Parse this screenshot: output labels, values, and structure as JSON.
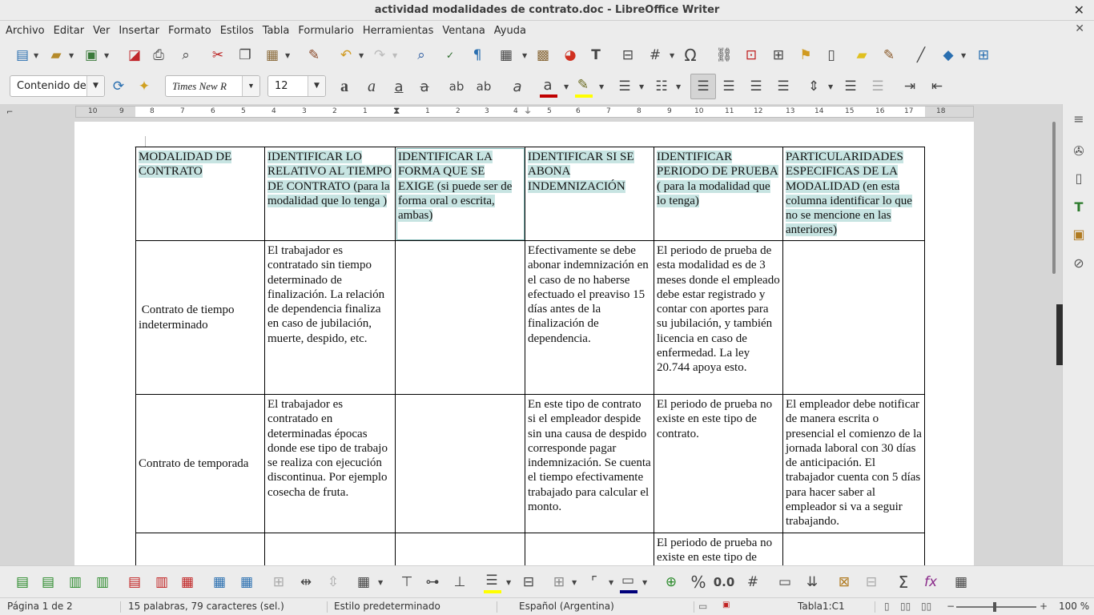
{
  "window": {
    "title": "actividad modalidades de contrato.doc - LibreOffice Writer",
    "close": "✕"
  },
  "menu": [
    "Archivo",
    "Editar",
    "Ver",
    "Insertar",
    "Formato",
    "Estilos",
    "Tabla",
    "Formulario",
    "Herramientas",
    "Ventana",
    "Ayuda"
  ],
  "format_bar": {
    "paragraph_style": "Contenido de",
    "font_name": "Times New R",
    "font_size": "12"
  },
  "ruler": {
    "labels_left": [
      "10",
      "9",
      "8",
      "7",
      "6",
      "5",
      "4",
      "3",
      "2",
      "1"
    ],
    "labels_mid": [
      "1",
      "2",
      "3",
      "4",
      "5",
      "6",
      "7",
      "8",
      "9",
      "10",
      "11",
      "12",
      "13",
      "14",
      "15",
      "16",
      "17",
      "18"
    ]
  },
  "table": {
    "headers": [
      "MODALIDAD DE CONTRATO",
      "IDENTIFICAR  LO RELATIVO AL TIEMPO DE CONTRATO (para la modalidad que lo tenga )",
      "IDENTIFICAR LA FORMA QUE SE EXIGE (si puede ser de forma oral o escrita, ambas)",
      "IDENTIFICAR SI SE ABONA INDEMNIZACIÓN",
      "IDENTIFICAR PERIODO DE PRUEBA ( para la modalidad que lo tenga)",
      "PARTICULARIDADES ESPECIFICAS DE LA MODALIDAD (en esta columna identificar lo que no se mencione en las anteriores)"
    ],
    "rows": [
      [
        " Contrato de tiempo indeterminado",
        "El trabajador es contratado sin tiempo determinado de finalización. La relación de dependencia finaliza en caso de jubilación, muerte, despido, etc.",
        "",
        "Efectivamente se debe abonar indemnización en el caso de no haberse efectuado el preaviso 15 días antes de la finalización de dependencia.",
        "El periodo de prueba de esta modalidad es de 3 meses donde el empleado debe estar registrado y contar con aportes para su jubilación, y también licencia en caso de enfermedad. La ley 20.744 apoya esto.",
        ""
      ],
      [
        "Contrato de temporada",
        "El trabajador es contratado en determinadas épocas donde ese tipo de trabajo se realiza con ejecución discontinua. Por ejemplo cosecha de fruta.",
        "",
        "En este tipo de contrato si el empleador despide sin una causa de despido corresponde pagar indemnización. Se cuenta el tiempo efectivamente trabajado para calcular el monto.",
        "El periodo de prueba no existe en este tipo de contrato.",
        "El empleador debe notificar de manera escrita o presencial el comienzo de la jornada laboral con 30 días de anticipación. El trabajador cuenta con 5 días para hacer saber al empleador si va a seguir trabajando."
      ],
      [
        "",
        "",
        "",
        "",
        "El periodo de prueba no existe en este tipo de contrato.",
        ""
      ]
    ]
  },
  "status": {
    "page": "Página 1 de 2",
    "words": "15 palabras, 79 caracteres (sel.)",
    "style": "Estilo predeterminado",
    "language": "Español (Argentina)",
    "cell": "Tabla1:C1",
    "zoom": "100 %"
  },
  "toolbar_text": {
    "percent": "%",
    "decimal": "0.0",
    "sum": "Σ",
    "fx": "fx",
    "omega": "Ω"
  },
  "colors": {
    "highlight": "#c7e4e2",
    "font_color": "#c00000",
    "highlight_tool": "#ffff00",
    "chrome": "#ececec"
  }
}
